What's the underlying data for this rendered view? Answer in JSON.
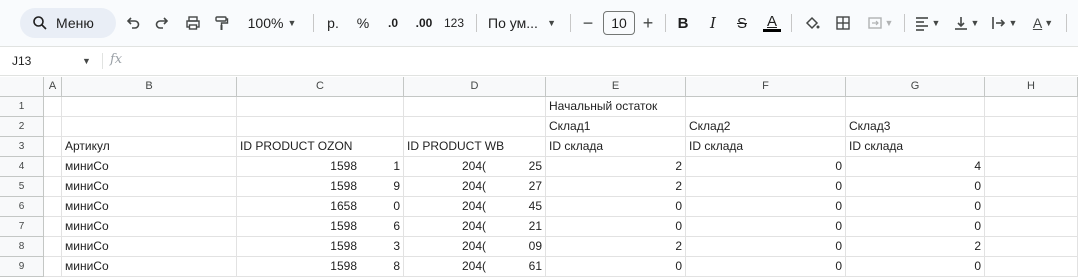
{
  "toolbar": {
    "search_label": "Меню",
    "zoom": "100%",
    "currency": "р.",
    "percent": "%",
    "dec_decrease": ".0",
    "dec_increase": ".00",
    "number_format": "123",
    "font_name": "По ум...",
    "font_size": "10",
    "bold": "B",
    "italic": "I",
    "strike": "S",
    "text_color": "A",
    "colors": {
      "accent": "#0b57d0",
      "text_color_bar": "#000000"
    }
  },
  "formula_bar": {
    "cell_ref": "J13",
    "fx": "fx",
    "value": ""
  },
  "columns": [
    {
      "key": "A",
      "label": "A"
    },
    {
      "key": "B",
      "label": "B"
    },
    {
      "key": "C",
      "label": "C"
    },
    {
      "key": "D",
      "label": "D"
    },
    {
      "key": "E",
      "label": "E"
    },
    {
      "key": "F",
      "label": "F"
    },
    {
      "key": "G",
      "label": "G"
    },
    {
      "key": "H",
      "label": "H"
    }
  ],
  "rows": [
    {
      "n": "1",
      "B": "",
      "C": "",
      "C2": "",
      "D": "",
      "D2": "",
      "E": "Начальный остаток",
      "F": "",
      "G": ""
    },
    {
      "n": "2",
      "B": "",
      "C": "",
      "C2": "",
      "D": "",
      "D2": "",
      "E": "Склад1",
      "F": "Склад2",
      "G": "Склад3"
    },
    {
      "n": "3",
      "B": "Артикул",
      "C": "ID PRODUCT OZON",
      "C2": "",
      "D": "ID PRODUCT WB",
      "D2": "",
      "E": "ID склада",
      "F": "ID склада",
      "G": "ID склада"
    },
    {
      "n": "4",
      "B": "миниСо",
      "C": "1598",
      "C2": "1",
      "D": "204(",
      "D2": "25",
      "E": "2",
      "F": "0",
      "G": "4"
    },
    {
      "n": "5",
      "B": "миниСо",
      "C": "1598",
      "C2": "9",
      "D": "204(",
      "D2": "27",
      "E": "2",
      "F": "0",
      "G": "0"
    },
    {
      "n": "6",
      "B": "миниСо",
      "C": "1658",
      "C2": "0",
      "D": "204(",
      "D2": "45",
      "E": "0",
      "F": "0",
      "G": "0"
    },
    {
      "n": "7",
      "B": "миниСо",
      "C": "1598",
      "C2": "6",
      "D": "204(",
      "D2": "21",
      "E": "0",
      "F": "0",
      "G": "0"
    },
    {
      "n": "8",
      "B": "миниСо",
      "C": "1598",
      "C2": "3",
      "D": "204(",
      "D2": "09",
      "E": "2",
      "F": "0",
      "G": "2"
    },
    {
      "n": "9",
      "B": "миниСо",
      "C": "1598",
      "C2": "8",
      "D": "204(",
      "D2": "61",
      "E": "0",
      "F": "0",
      "G": "0"
    }
  ]
}
